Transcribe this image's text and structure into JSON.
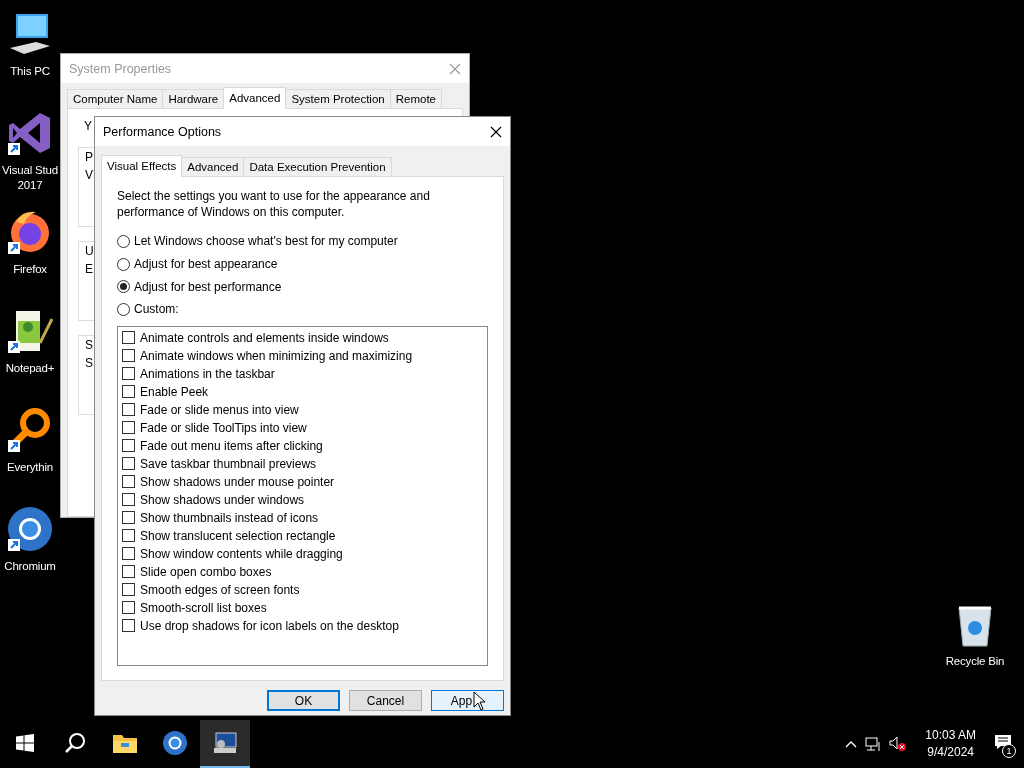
{
  "desktop_icons": [
    {
      "kind": "pc",
      "lines": [
        "This PC"
      ]
    },
    {
      "kind": "vs",
      "lines": [
        "Visual Stud",
        "2017"
      ]
    },
    {
      "kind": "firefox",
      "lines": [
        "Firefox"
      ]
    },
    {
      "kind": "notepad",
      "lines": [
        "Notepad+"
      ]
    },
    {
      "kind": "everything",
      "lines": [
        "Everythin"
      ]
    },
    {
      "kind": "chromium",
      "lines": [
        "Chromium"
      ]
    }
  ],
  "recycle_bin": {
    "kind": "recycle",
    "lines": [
      "Recycle Bin"
    ]
  },
  "system_properties": {
    "title": "System Properties",
    "tabs": [
      {
        "label": "Computer Name",
        "selected": false
      },
      {
        "label": "Hardware",
        "selected": false
      },
      {
        "label": "Advanced",
        "selected": true
      },
      {
        "label": "System Protection",
        "selected": false
      },
      {
        "label": "Remote",
        "selected": false
      }
    ],
    "intro": "Y",
    "groups": [
      [
        "P",
        "V"
      ],
      [
        "U",
        "E"
      ],
      [
        "S",
        "S"
      ]
    ]
  },
  "performance_options": {
    "title": "Performance Options",
    "tabs": [
      {
        "label": "Visual Effects",
        "selected": true
      },
      {
        "label": "Advanced",
        "selected": false
      },
      {
        "label": "Data Execution Prevention",
        "selected": false
      }
    ],
    "description": "Select the settings you want to use for the appearance and performance of Windows on this computer.",
    "radios": [
      {
        "label": "Let Windows choose what's best for my computer",
        "selected": false
      },
      {
        "label": "Adjust for best appearance",
        "selected": false
      },
      {
        "label": "Adjust for best performance",
        "selected": true
      },
      {
        "label": "Custom:",
        "selected": false
      }
    ],
    "checkboxes": [
      {
        "label": "Animate controls and elements inside windows",
        "checked": false
      },
      {
        "label": "Animate windows when minimizing and maximizing",
        "checked": false
      },
      {
        "label": "Animations in the taskbar",
        "checked": false
      },
      {
        "label": "Enable Peek",
        "checked": false
      },
      {
        "label": "Fade or slide menus into view",
        "checked": false
      },
      {
        "label": "Fade or slide ToolTips into view",
        "checked": false
      },
      {
        "label": "Fade out menu items after clicking",
        "checked": false
      },
      {
        "label": "Save taskbar thumbnail previews",
        "checked": false
      },
      {
        "label": "Show shadows under mouse pointer",
        "checked": false
      },
      {
        "label": "Show shadows under windows",
        "checked": false
      },
      {
        "label": "Show thumbnails instead of icons",
        "checked": false
      },
      {
        "label": "Show translucent selection rectangle",
        "checked": false
      },
      {
        "label": "Show window contents while dragging",
        "checked": false
      },
      {
        "label": "Slide open combo boxes",
        "checked": false
      },
      {
        "label": "Smooth edges of screen fonts",
        "checked": false
      },
      {
        "label": "Smooth-scroll list boxes",
        "checked": false
      },
      {
        "label": "Use drop shadows for icon labels on the desktop",
        "checked": false
      }
    ],
    "buttons": [
      {
        "label": "OK",
        "kind": "default"
      },
      {
        "label": "Cancel",
        "kind": "normal"
      },
      {
        "label": "App",
        "kind": "hover"
      }
    ]
  },
  "taskbar": {
    "apps": [
      {
        "kind": "explorer",
        "active": false
      },
      {
        "kind": "chromium",
        "active": false
      },
      {
        "kind": "sysprops",
        "active": true
      }
    ],
    "time": "10:03 AM",
    "date": "9/4/2024",
    "notifications": "1"
  }
}
